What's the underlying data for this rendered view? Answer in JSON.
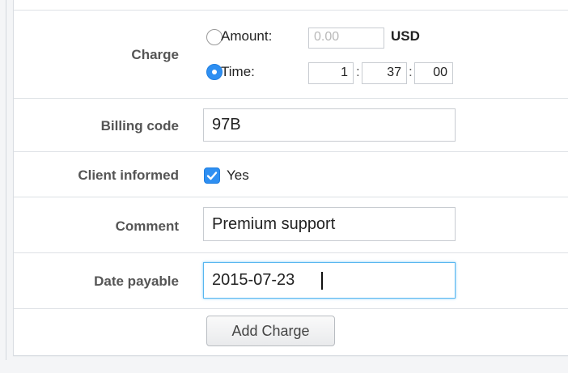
{
  "charge": {
    "label": "Charge",
    "amount_label": "Amount:",
    "amount_value": "0.00",
    "currency": "USD",
    "time_label": "Time:",
    "time_hours": "1",
    "time_minutes": "37",
    "time_seconds": "00",
    "separator": ":"
  },
  "billing_code": {
    "label": "Billing code",
    "value": "97B"
  },
  "client_informed": {
    "label": "Client informed",
    "checkbox_label": "Yes",
    "checked": true
  },
  "comment": {
    "label": "Comment",
    "value": "Premium support"
  },
  "date_payable": {
    "label": "Date payable",
    "value": "2015-07-23"
  },
  "actions": {
    "add_charge": "Add Charge"
  },
  "colors": {
    "accent": "#2e8ff2",
    "focus_border": "#58b7f0"
  }
}
